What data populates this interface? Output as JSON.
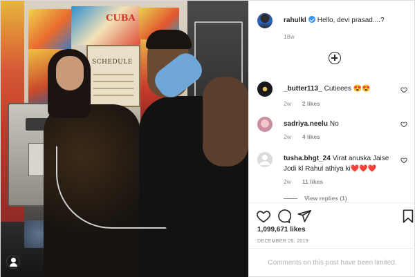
{
  "post": {
    "author": "rahulkl",
    "verified": true,
    "caption": "Hello, devi prasad....?",
    "age": "18w"
  },
  "photo": {
    "poster_text": "CUBA",
    "sign_text": "SCHEDULE"
  },
  "comments": [
    {
      "user": "_butter113_",
      "text": "Cutieees 😍😍",
      "age": "2w",
      "likes": "2 likes",
      "avatar_color": "#1a1a1a"
    },
    {
      "user": "sadriya.neelu",
      "text": "No",
      "age": "2w",
      "likes": "4 likes",
      "avatar_color": "#c98fa0"
    },
    {
      "user": "tusha.bhgt_24",
      "text": "Virat anuska Jaise Jodi kl Rahul athiya ki❤️❤️❤️",
      "age": "2w",
      "likes": "11 likes",
      "avatar_color": "#dbdbdb",
      "replies": "View replies (1)"
    }
  ],
  "stats": {
    "likes": "1,099,671 likes",
    "date": "DECEMBER 26, 2019"
  },
  "comment_box": {
    "text": "Comments on this post have been limited."
  },
  "icons": {
    "heart": "heart-icon",
    "comment": "comment-icon",
    "share": "share-icon",
    "save": "bookmark-icon",
    "more": "add-circle-icon",
    "verified": "verified-badge-icon"
  }
}
